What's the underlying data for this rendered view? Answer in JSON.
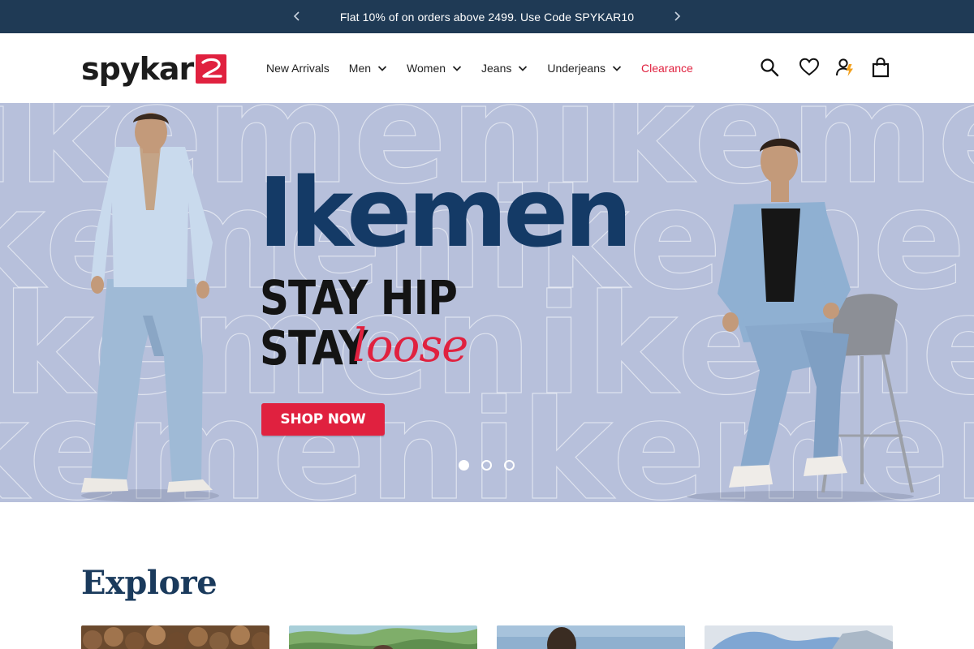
{
  "announcement": {
    "message": "Flat 10% of on orders above 2499. Use Code SPYKAR10",
    "prev_icon": "chevron-left-icon",
    "next_icon": "chevron-right-icon"
  },
  "header": {
    "logo_text": "spykar",
    "brand_color": "#e0213f",
    "nav": [
      {
        "label": "New Arrivals",
        "has_dropdown": false
      },
      {
        "label": "Men",
        "has_dropdown": true
      },
      {
        "label": "Women",
        "has_dropdown": true
      },
      {
        "label": "Jeans",
        "has_dropdown": true
      },
      {
        "label": "Underjeans",
        "has_dropdown": true
      },
      {
        "label": "Clearance",
        "has_dropdown": false,
        "highlight_color": "#e0213f"
      }
    ],
    "icons": [
      "search-icon",
      "heart-icon",
      "user-icon",
      "bag-icon"
    ]
  },
  "hero": {
    "background_color": "#b7c0db",
    "watermark_word": "ikemenikemen",
    "headline": "Ikemen",
    "tagline_line1": "STAY HIP",
    "tagline_line2_prefix": "STAY",
    "tagline_line2_script": "loose",
    "cta_label": "SHOP NOW",
    "slides_total": 3,
    "active_slide": 1
  },
  "explore": {
    "title": "Explore",
    "tiles": [
      "category-tile-1",
      "category-tile-2",
      "category-tile-3",
      "category-tile-4"
    ]
  }
}
